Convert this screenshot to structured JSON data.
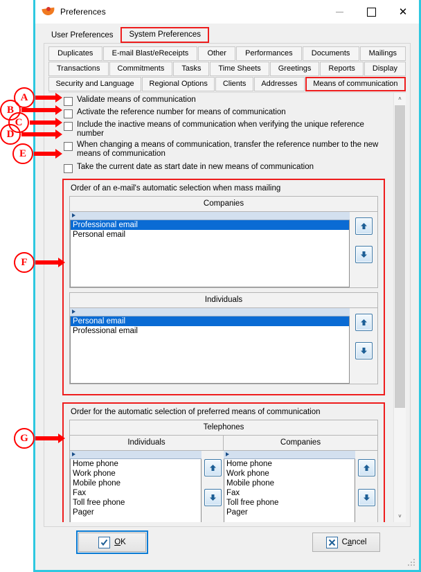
{
  "window": {
    "title": "Preferences",
    "icon": "app-swoosh-icon",
    "minimize": "—",
    "maximize": "□",
    "close": "✕"
  },
  "main_tabs": [
    {
      "label": "User Preferences",
      "selected": false
    },
    {
      "label": "System Preferences",
      "selected": true
    }
  ],
  "sub_tabs": [
    [
      {
        "label": "Duplicates",
        "active": false
      },
      {
        "label": "E-mail Blast/eReceipts",
        "active": false
      },
      {
        "label": "Other",
        "active": false
      },
      {
        "label": "Performances",
        "active": false
      },
      {
        "label": "Documents",
        "active": false
      },
      {
        "label": "Mailings",
        "active": false
      }
    ],
    [
      {
        "label": "Transactions",
        "active": false
      },
      {
        "label": "Commitments",
        "active": false
      },
      {
        "label": "Tasks",
        "active": false
      },
      {
        "label": "Time Sheets",
        "active": false
      },
      {
        "label": "Greetings",
        "active": false
      },
      {
        "label": "Reports",
        "active": false
      },
      {
        "label": "Display",
        "active": false
      }
    ],
    [
      {
        "label": "Security and Language",
        "active": false
      },
      {
        "label": "Regional Options",
        "active": false
      },
      {
        "label": "Clients",
        "active": false
      },
      {
        "label": "Addresses",
        "active": false
      },
      {
        "label": "Means of communication",
        "active": true
      }
    ]
  ],
  "checkboxes": [
    {
      "label": "Validate means of communication",
      "checked": false
    },
    {
      "label": "Activate the reference number for means of communication",
      "checked": false
    },
    {
      "label": "Include the inactive means of communication when verifying the unique reference number",
      "checked": false
    },
    {
      "label": "When changing a means of communication, transfer the reference number to the new means of communication",
      "checked": false
    },
    {
      "label": "Take the current date as start date in new means of communication",
      "checked": false
    }
  ],
  "group_email": {
    "title": "Order of an e-mail's automatic selection when mass mailing",
    "companies": {
      "header": "Companies",
      "items": [
        "Professional email",
        "Personal email"
      ],
      "selected_index": 0
    },
    "individuals": {
      "header": "Individuals",
      "items": [
        "Personal email",
        "Professional email"
      ],
      "selected_index": 0
    }
  },
  "group_phone": {
    "title": "Order for the automatic selection of preferred means of communication",
    "header": "Telephones",
    "individuals": {
      "header": "Individuals",
      "items": [
        "Home phone",
        "Work phone",
        "Mobile phone",
        "Fax",
        "Toll free phone",
        "Pager"
      ],
      "selected_index": -1
    },
    "companies": {
      "header": "Companies",
      "items": [
        "Home phone",
        "Work phone",
        "Mobile phone",
        "Fax",
        "Toll free phone",
        "Pager"
      ],
      "selected_index": -1
    }
  },
  "reorder_buttons": {
    "up": "move-up-arrow",
    "down": "move-down-arrow"
  },
  "footer": {
    "ok": "OK",
    "ok_accel": "O",
    "cancel": "Cancel",
    "cancel_accel": "a"
  },
  "annotations": [
    {
      "id": "A",
      "target": "checkbox-validate"
    },
    {
      "id": "B",
      "target": "checkbox-activate-reference"
    },
    {
      "id": "C",
      "target": "checkbox-include-inactive"
    },
    {
      "id": "D",
      "target": "checkbox-transfer-reference"
    },
    {
      "id": "E",
      "target": "checkbox-current-date"
    },
    {
      "id": "F",
      "target": "group-email-order"
    },
    {
      "id": "G",
      "target": "group-phone-order"
    }
  ],
  "colors": {
    "window_border": "#2ec8e0",
    "highlight_red": "#ee1c1c",
    "selection_blue": "#0a6bd4",
    "grid_header_blue": "#d3e0ef"
  },
  "scrollbar": {
    "up": "˄",
    "down": "˅"
  }
}
